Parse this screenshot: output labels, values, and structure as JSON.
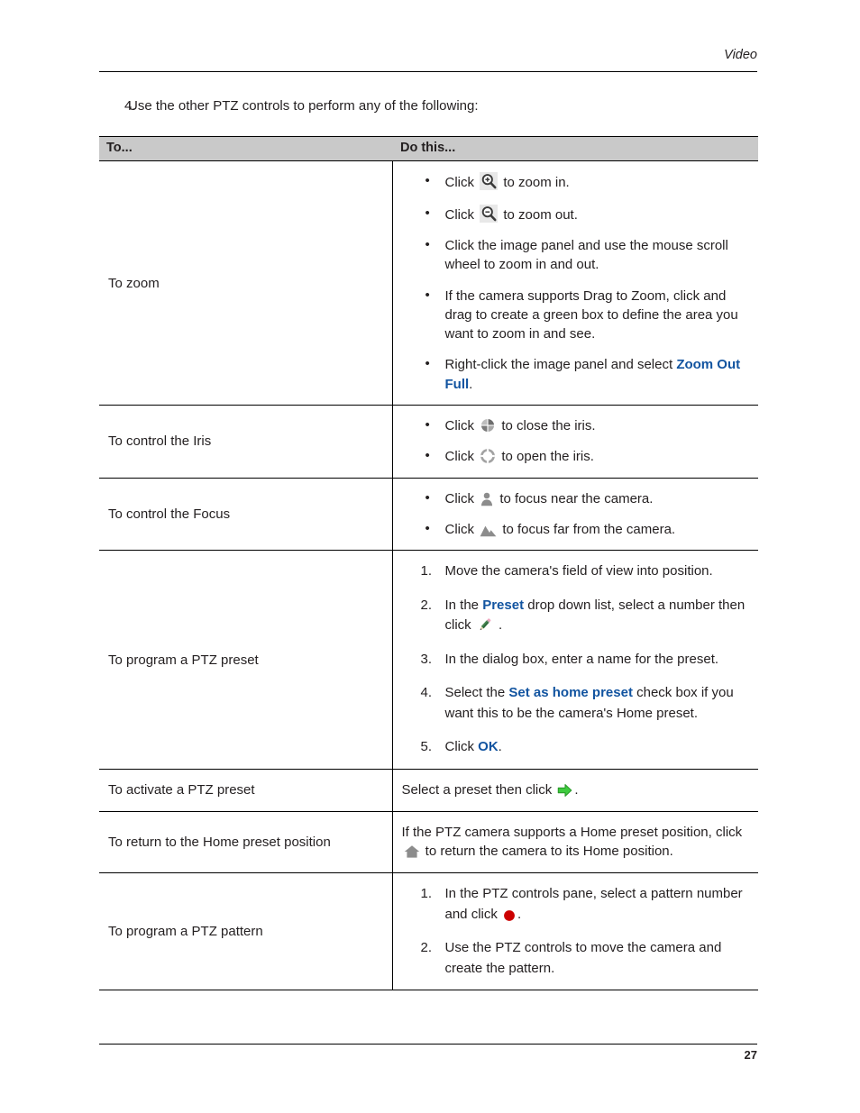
{
  "header": {
    "title": "Video"
  },
  "intro": {
    "number": "4.",
    "text": "Use the other PTZ controls to perform any of the following:"
  },
  "table": {
    "columns": [
      "To...",
      "Do this..."
    ],
    "rows": [
      {
        "label": "To zoom",
        "kind": "bullets",
        "items": [
          {
            "parts": [
              {
                "t": "text",
                "v": "Click "
              },
              {
                "t": "icon",
                "v": "zoom-in-icon"
              },
              {
                "t": "text",
                "v": " to zoom in."
              }
            ]
          },
          {
            "parts": [
              {
                "t": "text",
                "v": "Click "
              },
              {
                "t": "icon",
                "v": "zoom-out-icon"
              },
              {
                "t": "text",
                "v": " to zoom out."
              }
            ]
          },
          {
            "parts": [
              {
                "t": "text",
                "v": "Click the image panel and use the mouse scroll wheel to zoom in and out."
              }
            ]
          },
          {
            "parts": [
              {
                "t": "text",
                "v": "If the camera supports Drag to Zoom, click and drag to create a green box to define the area you want to zoom in and see."
              }
            ]
          },
          {
            "parts": [
              {
                "t": "text",
                "v": "Right-click the image panel and select "
              },
              {
                "t": "bold-blue",
                "v": "Zoom Out Full"
              },
              {
                "t": "text",
                "v": "."
              }
            ]
          }
        ]
      },
      {
        "label": "To control the Iris",
        "kind": "bullets",
        "items": [
          {
            "parts": [
              {
                "t": "text",
                "v": "Click "
              },
              {
                "t": "icon",
                "v": "iris-close-icon"
              },
              {
                "t": "text",
                "v": " to close the iris."
              }
            ]
          },
          {
            "parts": [
              {
                "t": "text",
                "v": "Click "
              },
              {
                "t": "icon",
                "v": "iris-open-icon"
              },
              {
                "t": "text",
                "v": " to open the iris."
              }
            ]
          }
        ]
      },
      {
        "label": "To control the Focus",
        "kind": "bullets",
        "items": [
          {
            "parts": [
              {
                "t": "text",
                "v": "Click "
              },
              {
                "t": "icon",
                "v": "focus-near-icon"
              },
              {
                "t": "text",
                "v": " to focus near the camera."
              }
            ]
          },
          {
            "parts": [
              {
                "t": "text",
                "v": "Click "
              },
              {
                "t": "icon",
                "v": "focus-far-icon"
              },
              {
                "t": "text",
                "v": " to focus far from the camera."
              }
            ]
          }
        ]
      },
      {
        "label": "To program a PTZ preset",
        "kind": "numbers",
        "items": [
          {
            "parts": [
              {
                "t": "text",
                "v": "Move the camera's field of view into position."
              }
            ]
          },
          {
            "parts": [
              {
                "t": "text",
                "v": "In the "
              },
              {
                "t": "bold-blue",
                "v": "Preset"
              },
              {
                "t": "text",
                "v": " drop down list, select a number then click "
              },
              {
                "t": "icon",
                "v": "pencil-icon"
              },
              {
                "t": "text",
                "v": " ."
              }
            ]
          },
          {
            "parts": [
              {
                "t": "text",
                "v": "In the dialog box, enter a name for the preset."
              }
            ]
          },
          {
            "parts": [
              {
                "t": "text",
                "v": "Select the "
              },
              {
                "t": "bold-blue",
                "v": "Set as home preset"
              },
              {
                "t": "text",
                "v": " check box if you want this to be the camera's Home preset."
              }
            ]
          },
          {
            "parts": [
              {
                "t": "text",
                "v": "Click "
              },
              {
                "t": "bold-blue",
                "v": "OK"
              },
              {
                "t": "text",
                "v": "."
              }
            ]
          }
        ]
      },
      {
        "label": "To activate a PTZ preset",
        "kind": "plain",
        "items": [
          {
            "parts": [
              {
                "t": "text",
                "v": "Select a preset then click "
              },
              {
                "t": "icon",
                "v": "green-arrow-icon"
              },
              {
                "t": "text",
                "v": "."
              }
            ]
          }
        ]
      },
      {
        "label": "To return to the Home preset position",
        "kind": "plain",
        "items": [
          {
            "parts": [
              {
                "t": "text",
                "v": "If the PTZ camera supports a Home preset position, click "
              },
              {
                "t": "icon",
                "v": "home-icon"
              },
              {
                "t": "text",
                "v": "  to return the camera to its Home position."
              }
            ]
          }
        ]
      },
      {
        "label": "To program a PTZ pattern",
        "kind": "numbers",
        "items": [
          {
            "parts": [
              {
                "t": "text",
                "v": "In the PTZ controls pane, select a pattern number and click "
              },
              {
                "t": "icon",
                "v": "record-icon"
              },
              {
                "t": "text",
                "v": "."
              }
            ]
          },
          {
            "parts": [
              {
                "t": "text",
                "v": "Use the PTZ controls to move the camera and create the pattern."
              }
            ]
          }
        ]
      }
    ]
  },
  "footer": {
    "page_number": "27"
  },
  "colors": {
    "link_blue": "#1254a0",
    "header_gray": "#c9c9c9",
    "icon_gray": "#8c8c8c",
    "arrow_green": "#3ecb3e",
    "record_red": "#cc0000",
    "text": "#231f20"
  }
}
